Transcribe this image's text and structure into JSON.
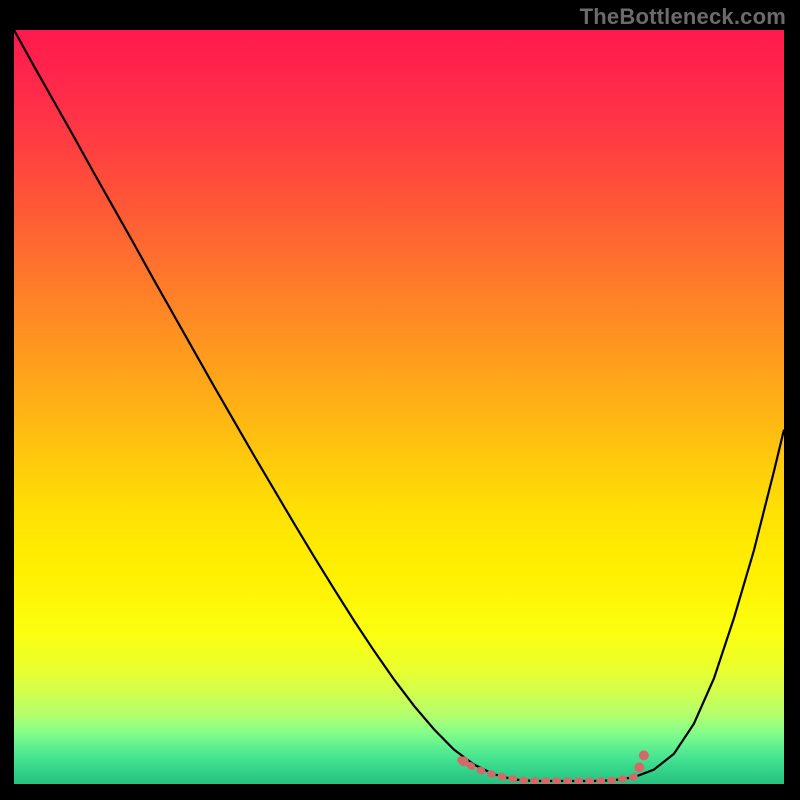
{
  "watermark": "TheBottleneck.com",
  "chart_data": {
    "type": "line",
    "title": "",
    "xlabel": "",
    "ylabel": "",
    "xlim": [
      0,
      100
    ],
    "ylim": [
      0,
      100
    ],
    "grid": false,
    "legend": false,
    "background_gradient": {
      "top": "#ff1a4d",
      "mid": "#ffe104",
      "bottom": "#30d088"
    },
    "series": [
      {
        "name": "bottleneck-curve",
        "color": "#000000",
        "x": [
          0.0,
          2.6,
          5.2,
          7.8,
          10.4,
          13.0,
          15.6,
          18.2,
          20.8,
          23.4,
          26.0,
          28.6,
          31.2,
          33.8,
          36.4,
          39.0,
          41.6,
          44.2,
          46.8,
          49.4,
          52.0,
          54.6,
          57.1,
          59.7,
          62.3,
          64.9,
          67.5,
          70.1,
          72.7,
          75.3,
          77.9,
          80.5,
          83.1,
          85.7,
          88.3,
          90.9,
          93.5,
          96.1,
          98.7,
          100.0
        ],
        "y": [
          100.0,
          95.2,
          90.5,
          85.8,
          81.0,
          76.3,
          71.6,
          66.8,
          62.1,
          57.4,
          52.7,
          48.1,
          43.5,
          39.0,
          34.5,
          30.1,
          25.8,
          21.6,
          17.6,
          13.8,
          10.3,
          7.2,
          4.6,
          2.6,
          1.3,
          0.6,
          0.4,
          0.4,
          0.4,
          0.4,
          0.5,
          0.9,
          1.9,
          4.0,
          8.0,
          14.0,
          22.0,
          31.0,
          41.5,
          47.0
        ]
      },
      {
        "name": "highlight-segment",
        "color": "#d26a6a",
        "x": [
          58.0,
          60.0,
          62.0,
          64.0,
          66.0,
          68.0,
          70.0,
          72.0,
          74.0,
          76.0,
          78.0,
          80.0,
          81.5
        ],
        "y": [
          3.2,
          2.0,
          1.3,
          0.8,
          0.5,
          0.4,
          0.4,
          0.4,
          0.4,
          0.4,
          0.5,
          0.8,
          1.2
        ]
      }
    ],
    "markers": [
      {
        "x": 58.4,
        "y": 3.0,
        "color": "#d26a6a"
      },
      {
        "x": 81.2,
        "y": 2.2,
        "color": "#d26a6a"
      },
      {
        "x": 81.8,
        "y": 3.8,
        "color": "#d26a6a"
      }
    ]
  }
}
